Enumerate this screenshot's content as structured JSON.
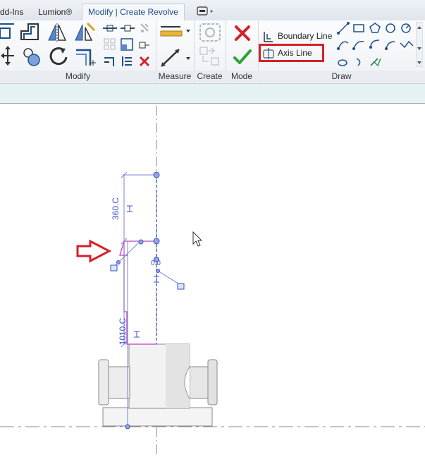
{
  "tabs": {
    "addins": "dd-Ins",
    "lumion": "Lumion®",
    "modify": "Modify | Create Revolve"
  },
  "panels": {
    "modify": "Modify",
    "measure": "Measure",
    "create": "Create",
    "mode": "Mode",
    "draw": "Draw"
  },
  "draw": {
    "boundary_line": "Boundary Line",
    "axis_line": "Axis Line"
  },
  "canvas": {
    "dim_top": "360.C",
    "dim_bottom": "1010.C",
    "dim_small": "0.0"
  },
  "colors": {
    "accent": "#1f4e8c",
    "highlight": "#d6202a",
    "sketch": "#c040c0",
    "dimension": "#3a4fc4"
  },
  "icons": [
    "arrow-icon",
    "cancel-icon",
    "finish-icon",
    "boundary-line-icon",
    "axis-line-icon",
    "cursor-icon"
  ]
}
